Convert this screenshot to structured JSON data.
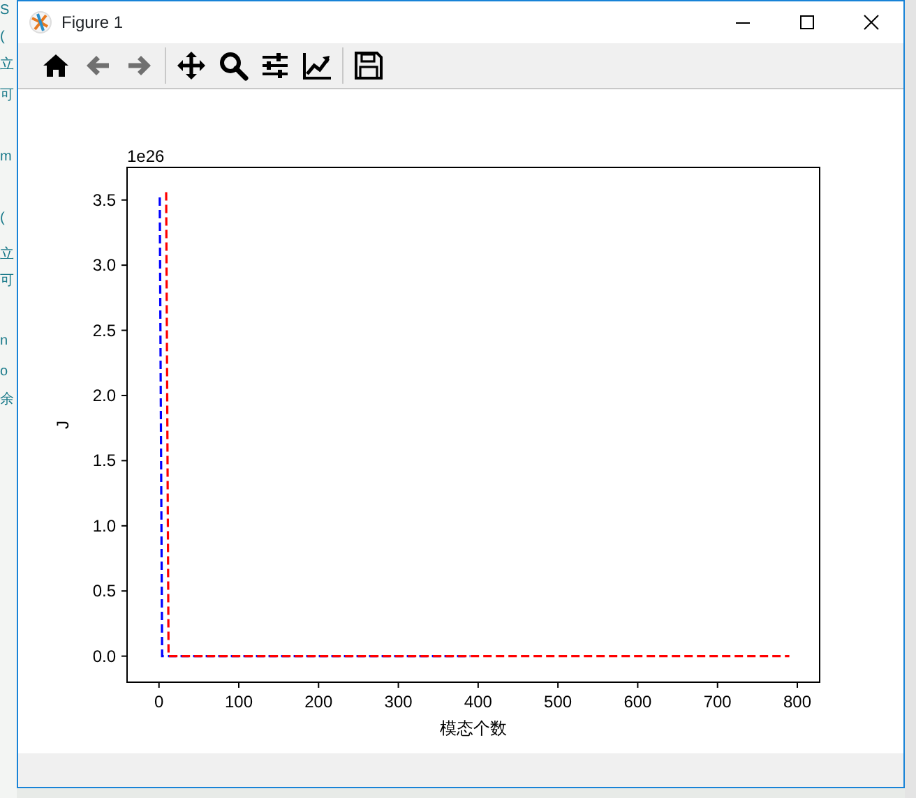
{
  "background_text": [
    {
      "text": "S"
    },
    {
      "text": "("
    },
    {
      "text": "立"
    },
    {
      "text": "可"
    },
    {
      "text": "m"
    },
    {
      "text": "("
    },
    {
      "text": "立"
    },
    {
      "text": "可"
    },
    {
      "text": "n"
    },
    {
      "text": "o"
    },
    {
      "text": "余"
    }
  ],
  "window": {
    "title": "Figure 1"
  },
  "toolbar": [
    {
      "kind": "home",
      "disabled": false
    },
    {
      "kind": "back",
      "disabled": true
    },
    {
      "kind": "forward",
      "disabled": true
    },
    {
      "kind": "separator"
    },
    {
      "kind": "pan",
      "disabled": false
    },
    {
      "kind": "zoom",
      "disabled": false
    },
    {
      "kind": "subplots",
      "disabled": false
    },
    {
      "kind": "customize",
      "disabled": false
    },
    {
      "kind": "separator"
    },
    {
      "kind": "save",
      "disabled": false
    }
  ],
  "chart_data": {
    "type": "line",
    "xlabel": "模态个数",
    "ylabel": "J",
    "annotations": [
      {
        "text": "1e26"
      }
    ],
    "x": [
      1,
      4,
      9,
      12,
      390,
      790
    ],
    "series": [
      {
        "color": "#0000ff",
        "line_style": "dashed",
        "values": [
          3.52,
          0,
          0,
          0,
          0,
          null
        ]
      },
      {
        "color": "#ff0000",
        "line_style": "dashed",
        "values": [
          null,
          null,
          3.56,
          0,
          0,
          0
        ]
      }
    ],
    "xlim": [
      -40,
      828
    ],
    "ylim": [
      -0.2,
      3.75
    ],
    "xticks": [
      0,
      100,
      200,
      300,
      400,
      500,
      600,
      700,
      800
    ],
    "yticks": [
      {
        "value": 0,
        "label": "0.0"
      },
      {
        "value": 0.5,
        "label": "0.5"
      },
      {
        "value": 1,
        "label": "1.0"
      },
      {
        "value": 1.5,
        "label": "1.5"
      },
      {
        "value": 2,
        "label": "2.0"
      },
      {
        "value": 2.5,
        "label": "2.5"
      },
      {
        "value": 3,
        "label": "3.0"
      },
      {
        "value": 3.5,
        "label": "3.5"
      }
    ]
  }
}
